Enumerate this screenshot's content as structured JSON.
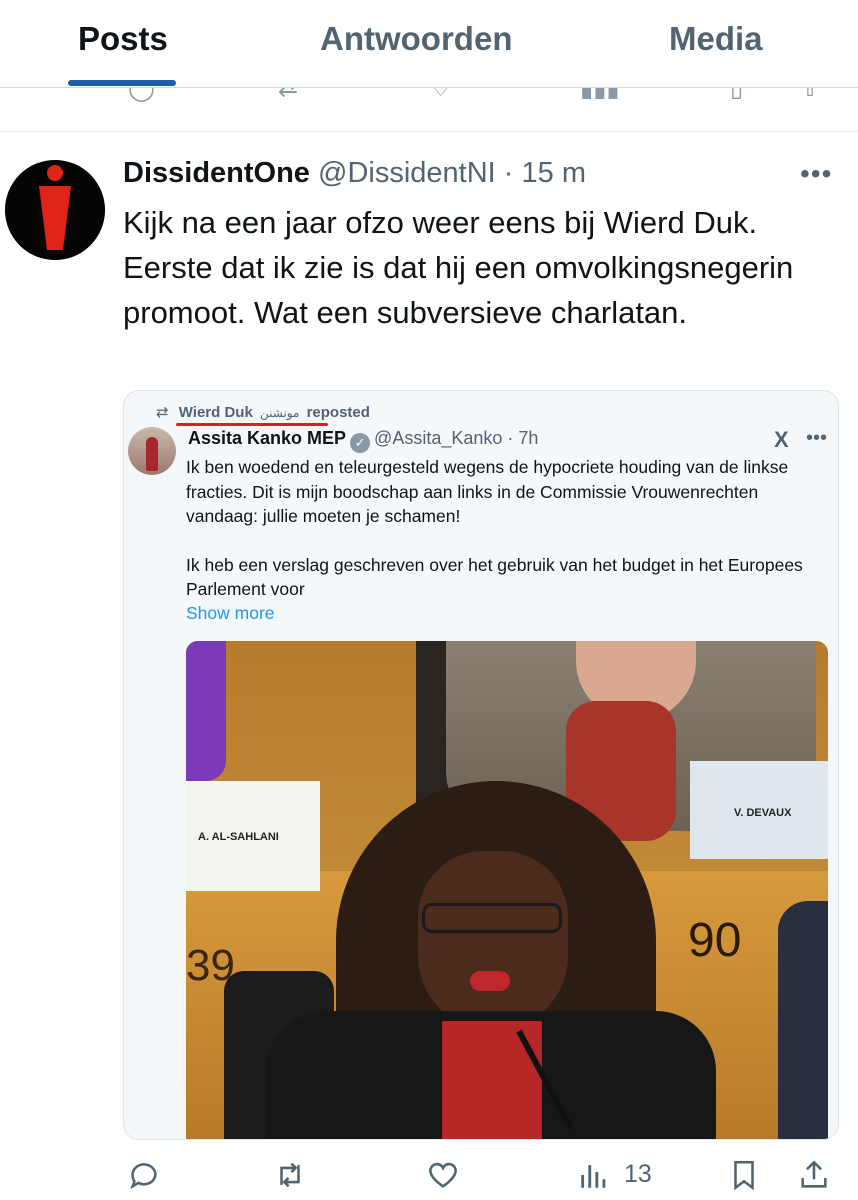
{
  "tabs": [
    {
      "label": "Posts",
      "active": true
    },
    {
      "label": "Antwoorden",
      "active": false
    },
    {
      "label": "Media",
      "active": false
    }
  ],
  "tweet": {
    "author_name": "DissidentOne",
    "handle": "@DissidentNI",
    "separator": "·",
    "time": "15 m",
    "text": "Kijk na een jaar ofzo weer eens bij Wierd Duk. Eerste dat ik zie is dat hij een omvolkingsnegerin promoot. Wat een subversieve charlatan."
  },
  "quote": {
    "reposter_name": "Wierd Duk",
    "reposter_emoji": "مونشنن",
    "repost_label": "reposted",
    "author_name": "Assita Kanko MEP",
    "handle": "@Assita_Kanko",
    "separator": "·",
    "time": "7h",
    "paragraph1": "Ik ben woedend en teleurgesteld wegens de hypocriete houding van de linkse fracties. Dit is mijn boodschap aan links in de Commissie Vrouwenrechten vandaag: jullie moeten je schamen!",
    "paragraph2": "Ik heb een verslag geschreven over het gebruik van het budget in het Europees Parlement voor",
    "show_more": "Show more",
    "photo_signs": {
      "left": "A. AL-SAHLANI",
      "right": "V. DEVAUX",
      "num_left": "39",
      "num_right": "90"
    }
  },
  "actions": {
    "views_count": "13"
  },
  "icons": [
    "more-icon",
    "repost-icon",
    "verified-icon",
    "x-logo-icon",
    "reply-icon",
    "retweet-icon",
    "like-icon",
    "views-icon",
    "bookmark-icon",
    "share-icon"
  ],
  "colors": {
    "accent": "#1d5fa8",
    "link": "#1d9bf0",
    "muted": "#536471",
    "underline_red": "#d71f28"
  }
}
